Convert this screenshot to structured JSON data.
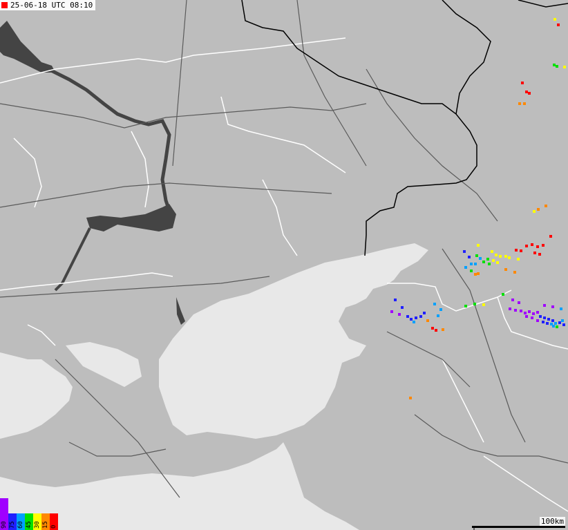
{
  "timestamp": {
    "text": "25-06-18 UTC 08:10",
    "marker_color": "#ff0000"
  },
  "legend": {
    "labels": [
      "90",
      "75",
      "60",
      "45",
      "30",
      "15",
      "0"
    ],
    "colors": [
      "#a000ff",
      "#2020ff",
      "#00a0ff",
      "#00e000",
      "#ffff00",
      "#ff8800",
      "#ff0000"
    ]
  },
  "scale": {
    "label": "100km"
  },
  "colors": {
    "land": "#bdbdbd",
    "sea": "#e8e8e8",
    "water": "#444444",
    "border": "#000000",
    "region": "#ffffff",
    "road": "#5a5a5a"
  }
}
